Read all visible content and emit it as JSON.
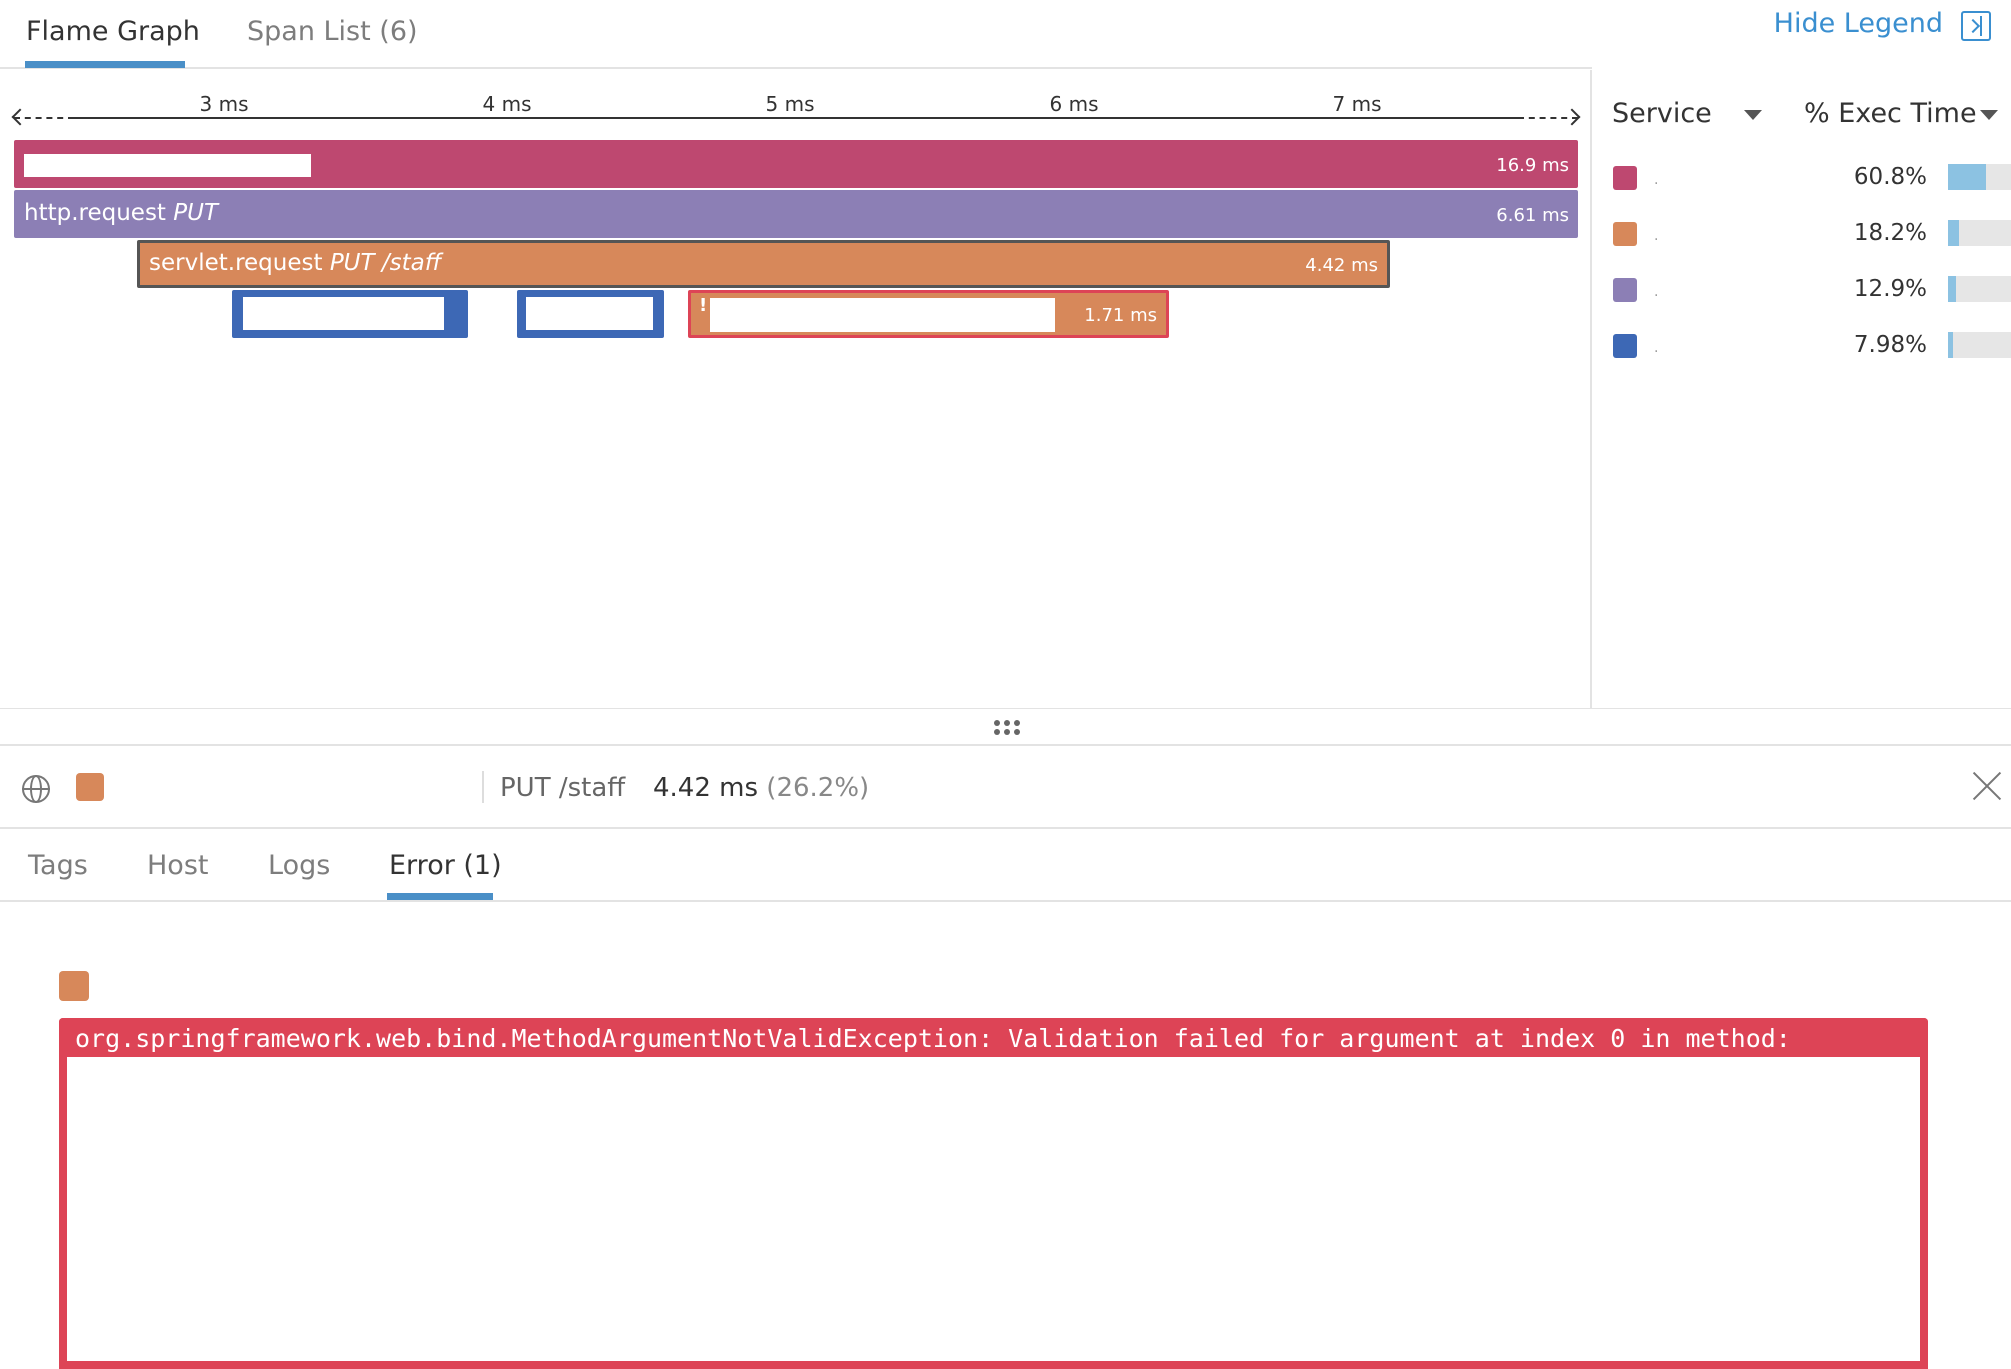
{
  "top_tabs": {
    "flame_graph": "Flame Graph",
    "span_list": "Span List (6)",
    "hide_legend": "Hide Legend"
  },
  "timeline": {
    "ticks": [
      "3 ms",
      "4 ms",
      "5 ms",
      "6 ms",
      "7 ms"
    ]
  },
  "spans": {
    "root": {
      "duration": "16.9 ms",
      "color": "#be4870"
    },
    "http": {
      "name": "http.request",
      "resource": "PUT",
      "duration": "6.61 ms",
      "color": "#8c7fb5"
    },
    "servlet": {
      "name": "servlet.request",
      "resource": "PUT /staff",
      "duration": "4.42 ms",
      "color": "#d7885a"
    },
    "child_error": {
      "duration": "1.71 ms",
      "color": "#d7885a",
      "error_marker": "!"
    }
  },
  "legend": {
    "service_header": "Service",
    "exec_header": "% Exec Time",
    "rows": [
      {
        "color": "#be4870",
        "dot": "·",
        "pct": "60.8%",
        "fill": 0.608
      },
      {
        "color": "#d7885a",
        "dot": "·",
        "pct": "18.2%",
        "fill": 0.182
      },
      {
        "color": "#8c7fb5",
        "dot": "·",
        "pct": "12.9%",
        "fill": 0.129
      },
      {
        "color": "#3d68b5",
        "dot": "·",
        "pct": "7.98%",
        "fill": 0.0798
      }
    ]
  },
  "detail": {
    "resource": "PUT /staff",
    "duration": "4.42 ms",
    "pct": "(26.2%)",
    "tabs": [
      "Tags",
      "Host",
      "Logs",
      "Error (1)"
    ]
  },
  "error": {
    "message": "org.springframework.web.bind.MethodArgumentNotValidException: Validation failed for argument at index 0 in method:"
  }
}
